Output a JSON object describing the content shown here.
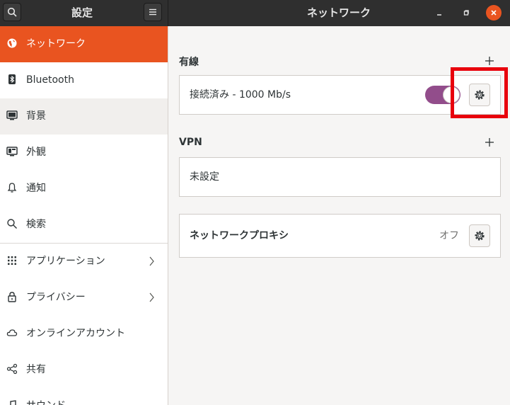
{
  "header": {
    "sidebar_title": "設定",
    "page_title": "ネットワーク"
  },
  "sidebar": {
    "items": [
      {
        "label": "ネットワーク",
        "icon": "globe-icon",
        "active": true
      },
      {
        "label": "Bluetooth",
        "icon": "bluetooth-icon"
      },
      {
        "label": "背景",
        "icon": "background-icon",
        "hover": true
      },
      {
        "label": "外観",
        "icon": "appearance-icon"
      },
      {
        "label": "通知",
        "icon": "bell-icon"
      },
      {
        "label": "検索",
        "icon": "search-icon"
      },
      {
        "label": "アプリケーション",
        "icon": "apps-grid-icon",
        "chevron": true
      },
      {
        "label": "プライバシー",
        "icon": "lock-icon",
        "chevron": true
      },
      {
        "label": "オンラインアカウント",
        "icon": "cloud-icon"
      },
      {
        "label": "共有",
        "icon": "share-icon"
      },
      {
        "label": "サウンド",
        "icon": "music-note-icon"
      }
    ]
  },
  "main": {
    "wired": {
      "title": "有線",
      "connection_label": "接続済み - 1000 Mb/s",
      "switch_on": true
    },
    "vpn": {
      "title": "VPN",
      "status_label": "未設定"
    },
    "proxy": {
      "label": "ネットワークプロキシ",
      "status": "オフ"
    }
  },
  "colors": {
    "accent": "#e95420",
    "switch_on": "#924d8b",
    "highlight": "#e8000c",
    "headerbar": "#2f2f2f"
  }
}
